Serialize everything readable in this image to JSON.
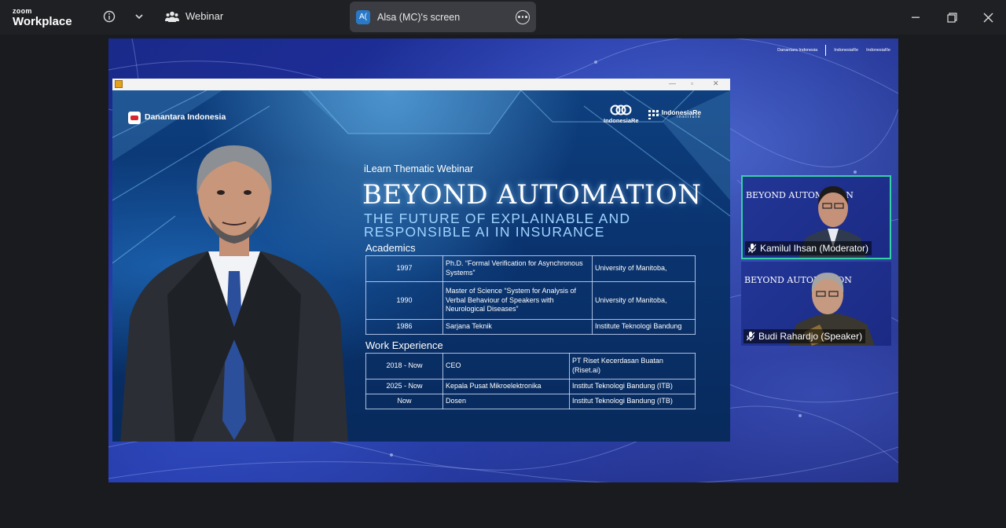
{
  "app": {
    "brand_top": "zoom",
    "brand_bottom": "Workplace",
    "meeting_name": "Webinar",
    "share_avatar": "A(",
    "share_label": "Alsa (MC)'s screen",
    "icons": [
      "info-icon",
      "chevron-down-icon",
      "participants-icon",
      "more-options-icon",
      "minimize-icon",
      "restore-icon",
      "close-icon"
    ]
  },
  "slide": {
    "danantara_logo": "Danantara Indonesia",
    "indonesiare_logo": "IndonesiaRe",
    "institute_logo": "IndonesiaRe",
    "institute_tag": "institute",
    "kicker": "iLearn Thematic Webinar",
    "headline": "BEYOND AUTOMATION",
    "subhead_line1": "THE FUTURE OF EXPLAINABLE AND",
    "subhead_line2": "RESPONSIBLE AI IN INSURANCE",
    "academics_title": "Academics",
    "academics": [
      {
        "year": "1997",
        "degree": "Ph.D. “Formal Verification for Asynchronous Systems”",
        "institution": "University of Manitoba,"
      },
      {
        "year": "1990",
        "degree": "Master of Science “System for Analysis of Verbal Behaviour of Speakers with Neurological Diseases”",
        "institution": "University of Manitoba,"
      },
      {
        "year": "1986",
        "degree": "Sarjana Teknik",
        "institution": "Institute Teknologi Bandung"
      }
    ],
    "work_title": "Work Experience",
    "work": [
      {
        "period": "2018 - Now",
        "role": "CEO",
        "organization": "PT Riset Kecerdasan Buatan (Riset.ai)"
      },
      {
        "period": "2025 - Now",
        "role": "Kepala Pusat Mikroelektronika",
        "organization": "Institut Teknologi Bandung (ITB)"
      },
      {
        "period": "Now",
        "role": "Dosen",
        "organization": "Institut Teknologi Bandung (ITB)"
      }
    ]
  },
  "participants": [
    {
      "name": "Kamilul Ihsan (Moderator)",
      "active": true
    },
    {
      "name": "Budi Rahardjo (Speaker)",
      "active": false
    }
  ],
  "stage_logos": {
    "left": "Danantara Indonesia",
    "mid": "IndonesiaRe",
    "right": "IndonesiaRe"
  },
  "colors": {
    "accent_active_speaker": "#35d2a5",
    "stage_bg": "#1e2f9e",
    "titlebar": "#1f2023"
  }
}
